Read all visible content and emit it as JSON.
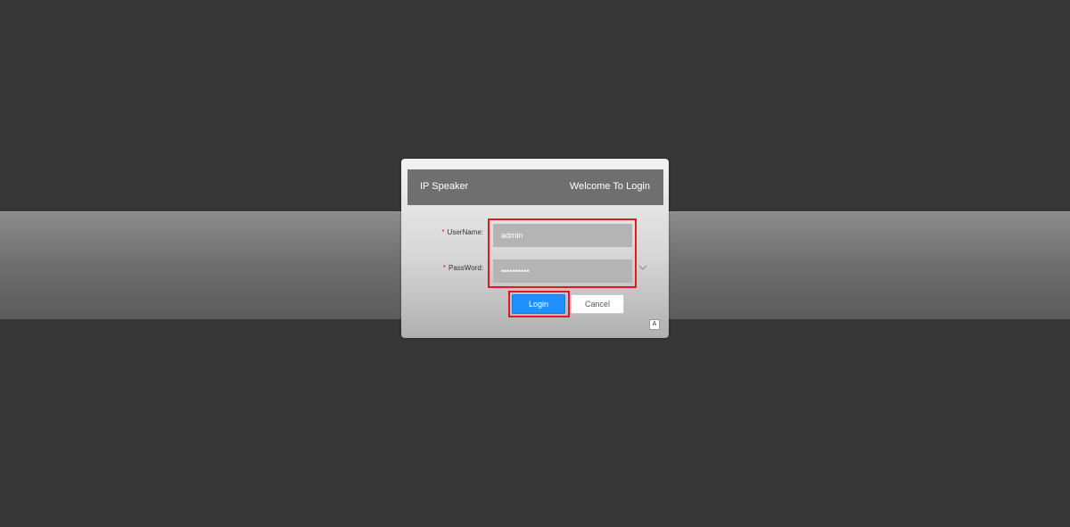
{
  "header": {
    "app_title": "IP Speaker",
    "welcome": "Welcome To Login"
  },
  "form": {
    "username": {
      "required_mark": "*",
      "label": "UserName:",
      "value": "admin"
    },
    "password": {
      "required_mark": "*",
      "label": "PassWord:",
      "value": "••••••••••"
    }
  },
  "buttons": {
    "login": "Login",
    "cancel": "Cancel"
  },
  "icons": {
    "language": "A"
  },
  "colors": {
    "accent": "#1e90ff",
    "highlight": "#e01a22",
    "header_bg": "#6f6f6f",
    "page_bg": "#363636"
  }
}
